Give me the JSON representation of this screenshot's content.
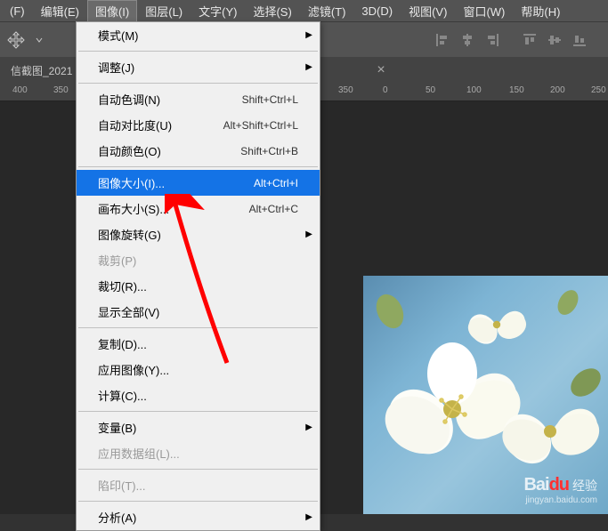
{
  "menubar": {
    "items": [
      "(F)",
      "编辑(E)",
      "图像(I)",
      "图层(L)",
      "文字(Y)",
      "选择(S)",
      "滤镜(T)",
      "3D(D)",
      "视图(V)",
      "窗口(W)",
      "帮助(H)"
    ],
    "active_index": 2
  },
  "tabs": {
    "name": "信截图_2021",
    "close": "×"
  },
  "ruler": {
    "marks": [
      "400",
      "350",
      "350",
      "0",
      "50",
      "100",
      "150",
      "200",
      "250"
    ]
  },
  "dropdown": {
    "items": [
      {
        "label": "模式(M)",
        "submenu": true
      },
      {
        "sep": true
      },
      {
        "label": "调整(J)",
        "submenu": true
      },
      {
        "sep": true
      },
      {
        "label": "自动色调(N)",
        "shortcut": "Shift+Ctrl+L"
      },
      {
        "label": "自动对比度(U)",
        "shortcut": "Alt+Shift+Ctrl+L"
      },
      {
        "label": "自动颜色(O)",
        "shortcut": "Shift+Ctrl+B"
      },
      {
        "sep": true
      },
      {
        "label": "图像大小(I)...",
        "shortcut": "Alt+Ctrl+I",
        "highlighted": true
      },
      {
        "label": "画布大小(S)...",
        "shortcut": "Alt+Ctrl+C"
      },
      {
        "label": "图像旋转(G)",
        "submenu": true
      },
      {
        "label": "裁剪(P)",
        "disabled": true
      },
      {
        "label": "裁切(R)..."
      },
      {
        "label": "显示全部(V)"
      },
      {
        "sep": true
      },
      {
        "label": "复制(D)..."
      },
      {
        "label": "应用图像(Y)..."
      },
      {
        "label": "计算(C)..."
      },
      {
        "sep": true
      },
      {
        "label": "变量(B)",
        "submenu": true
      },
      {
        "label": "应用数据组(L)...",
        "disabled": true
      },
      {
        "sep": true
      },
      {
        "label": "陷印(T)...",
        "disabled": true
      },
      {
        "sep": true
      },
      {
        "label": "分析(A)",
        "submenu": true
      }
    ]
  },
  "watermark": {
    "logo": "Bai",
    "du": "du",
    "jy": "经验",
    "url": "jingyan.baidu.com"
  }
}
